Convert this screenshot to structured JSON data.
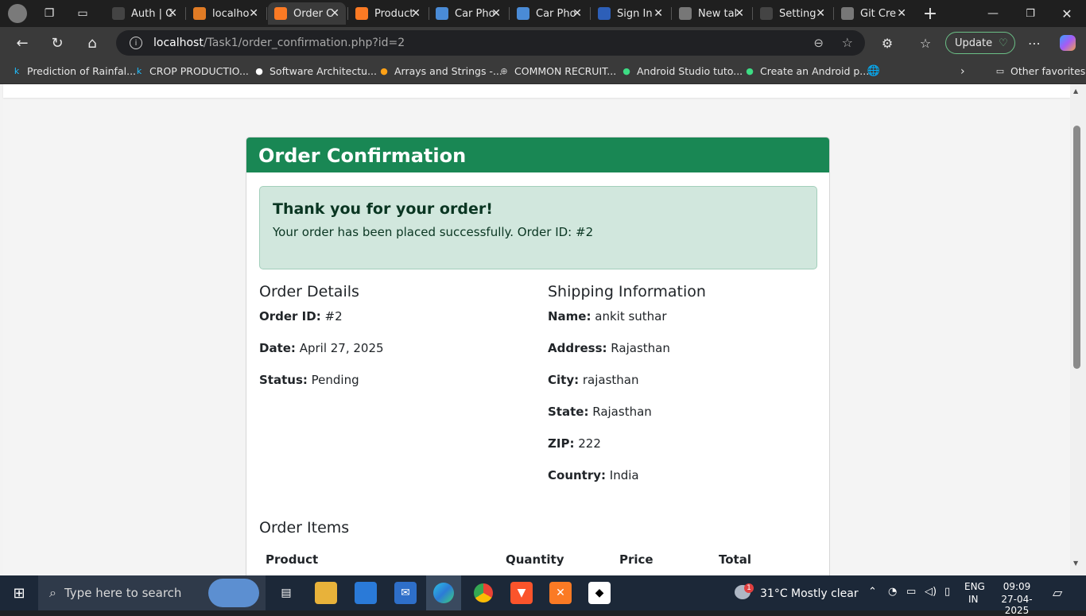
{
  "browser": {
    "tabs": [
      {
        "title": "Auth | C",
        "icon": "cube-logo-icon",
        "color": "#444444",
        "active": false
      },
      {
        "title": "localho",
        "icon": "phpmyadmin-icon",
        "color": "#e07b25",
        "active": false
      },
      {
        "title": "Order C",
        "icon": "xampp-icon",
        "color": "#fb7a24",
        "active": true
      },
      {
        "title": "Product",
        "icon": "xampp-icon",
        "color": "#fb7a24",
        "active": false
      },
      {
        "title": "Car Pho",
        "icon": "search-icon",
        "color": "#4a8bd6",
        "active": false
      },
      {
        "title": "Car Pho",
        "icon": "search-icon",
        "color": "#4a8bd6",
        "active": false
      },
      {
        "title": "Sign In",
        "icon": "zoom-icon",
        "color": "#2d5fb8",
        "active": false
      },
      {
        "title": "New tal",
        "icon": "new-tab-icon",
        "color": "#777777",
        "active": false
      },
      {
        "title": "Setting",
        "icon": "cube-logo-icon",
        "color": "#444444",
        "active": false
      },
      {
        "title": "Git Cre",
        "icon": "globe-icon",
        "color": "#777777",
        "active": false
      }
    ],
    "address": {
      "host": "localhost",
      "path": "/Task1/order_confirmation.php?id=2"
    },
    "update_label": "Update",
    "bookmarks": [
      {
        "label": "Prediction of Rainfal...",
        "icon": "kaggle-icon"
      },
      {
        "label": "CROP PRODUCTIO...",
        "icon": "kaggle-icon"
      },
      {
        "label": "Software Architectu...",
        "icon": "doc-icon"
      },
      {
        "label": "Arrays and Strings -...",
        "icon": "leetcode-icon"
      },
      {
        "label": "COMMON RECRUIT...",
        "icon": "globe-icon"
      },
      {
        "label": "Android Studio tuto...",
        "icon": "android-circle-icon"
      },
      {
        "label": "Create an Android p...",
        "icon": "android-icon"
      }
    ],
    "other_favorites": "Other favorites"
  },
  "page": {
    "header_title": "Order Confirmation",
    "alert_title": "Thank you for your order!",
    "alert_message": "Your order has been placed successfully. Order ID: #2",
    "order_details": {
      "heading": "Order Details",
      "rows": [
        {
          "label": "Order ID:",
          "value": "#2"
        },
        {
          "label": "Date:",
          "value": "April 27, 2025"
        },
        {
          "label": "Status:",
          "value": "Pending"
        }
      ]
    },
    "shipping": {
      "heading": "Shipping Information",
      "rows": [
        {
          "label": "Name:",
          "value": "ankit suthar"
        },
        {
          "label": "Address:",
          "value": "Rajasthan"
        },
        {
          "label": "City:",
          "value": "rajasthan"
        },
        {
          "label": "State:",
          "value": "Rajasthan"
        },
        {
          "label": "ZIP:",
          "value": "222"
        },
        {
          "label": "Country:",
          "value": "India"
        }
      ]
    },
    "items_heading": "Order Items",
    "table_headers": [
      "Product",
      "Quantity",
      "Price",
      "Total"
    ],
    "colors": {
      "header": "#198754",
      "alert_bg": "#d1e7dd",
      "alert_text": "#0a3622"
    }
  },
  "taskbar": {
    "search_placeholder": "Type here to search",
    "weather": "31°C  Mostly clear",
    "lang": "ENG",
    "region": "IN",
    "time": "09:09",
    "date": "27-04-2025",
    "weather_badge": "1"
  }
}
